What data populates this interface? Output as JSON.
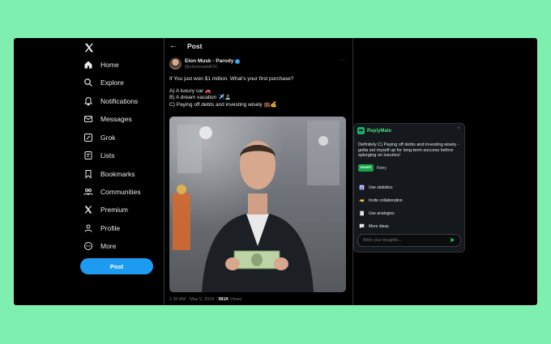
{
  "nav": {
    "items": [
      {
        "label": "Home",
        "icon": "home-icon"
      },
      {
        "label": "Explore",
        "icon": "search-icon"
      },
      {
        "label": "Notifications",
        "icon": "bell-icon"
      },
      {
        "label": "Messages",
        "icon": "envelope-icon"
      },
      {
        "label": "Grok",
        "icon": "grok-icon"
      },
      {
        "label": "Lists",
        "icon": "list-icon"
      },
      {
        "label": "Bookmarks",
        "icon": "bookmark-icon"
      },
      {
        "label": "Communities",
        "icon": "people-icon"
      },
      {
        "label": "Premium",
        "icon": "x-logo-icon"
      },
      {
        "label": "Profile",
        "icon": "user-icon"
      },
      {
        "label": "More",
        "icon": "more-circle-icon"
      }
    ],
    "post_button": "Post"
  },
  "header": {
    "title": "Post"
  },
  "tweet": {
    "author": "Elon Musk - Parody",
    "handle": "@elonmuskAOC",
    "lines": [
      "If You just won $1 million. What's your first purchase?",
      "A) A luxury car 🚗",
      "B) A dream vacation ✈️🏝️",
      "C) Paying off debts and investing wisely 💼💰"
    ],
    "timestamp": "1:30 AM · May 5, 2024 · ",
    "views_count": "381K",
    "views_label": " Views"
  },
  "replymate": {
    "title": "ReplyMate",
    "suggestion": "Definitely C) Paying off debts and investing wisely - gotta set myself up for long-term success before splurging on luxuries!",
    "insert_label": "Insert",
    "retry_label": "Retry",
    "options": [
      {
        "label": "Use statistics",
        "icon": "chart-icon"
      },
      {
        "label": "Invite collaboration",
        "icon": "handshake-icon"
      },
      {
        "label": "Use analogies",
        "icon": "book-icon"
      },
      {
        "label": "More ideas",
        "icon": "chat-icon"
      }
    ],
    "input_placeholder": "Write your thoughts..."
  },
  "colors": {
    "accent": "#1d9bf0",
    "brand_green": "#16a34a",
    "background": "#7fefb0"
  }
}
